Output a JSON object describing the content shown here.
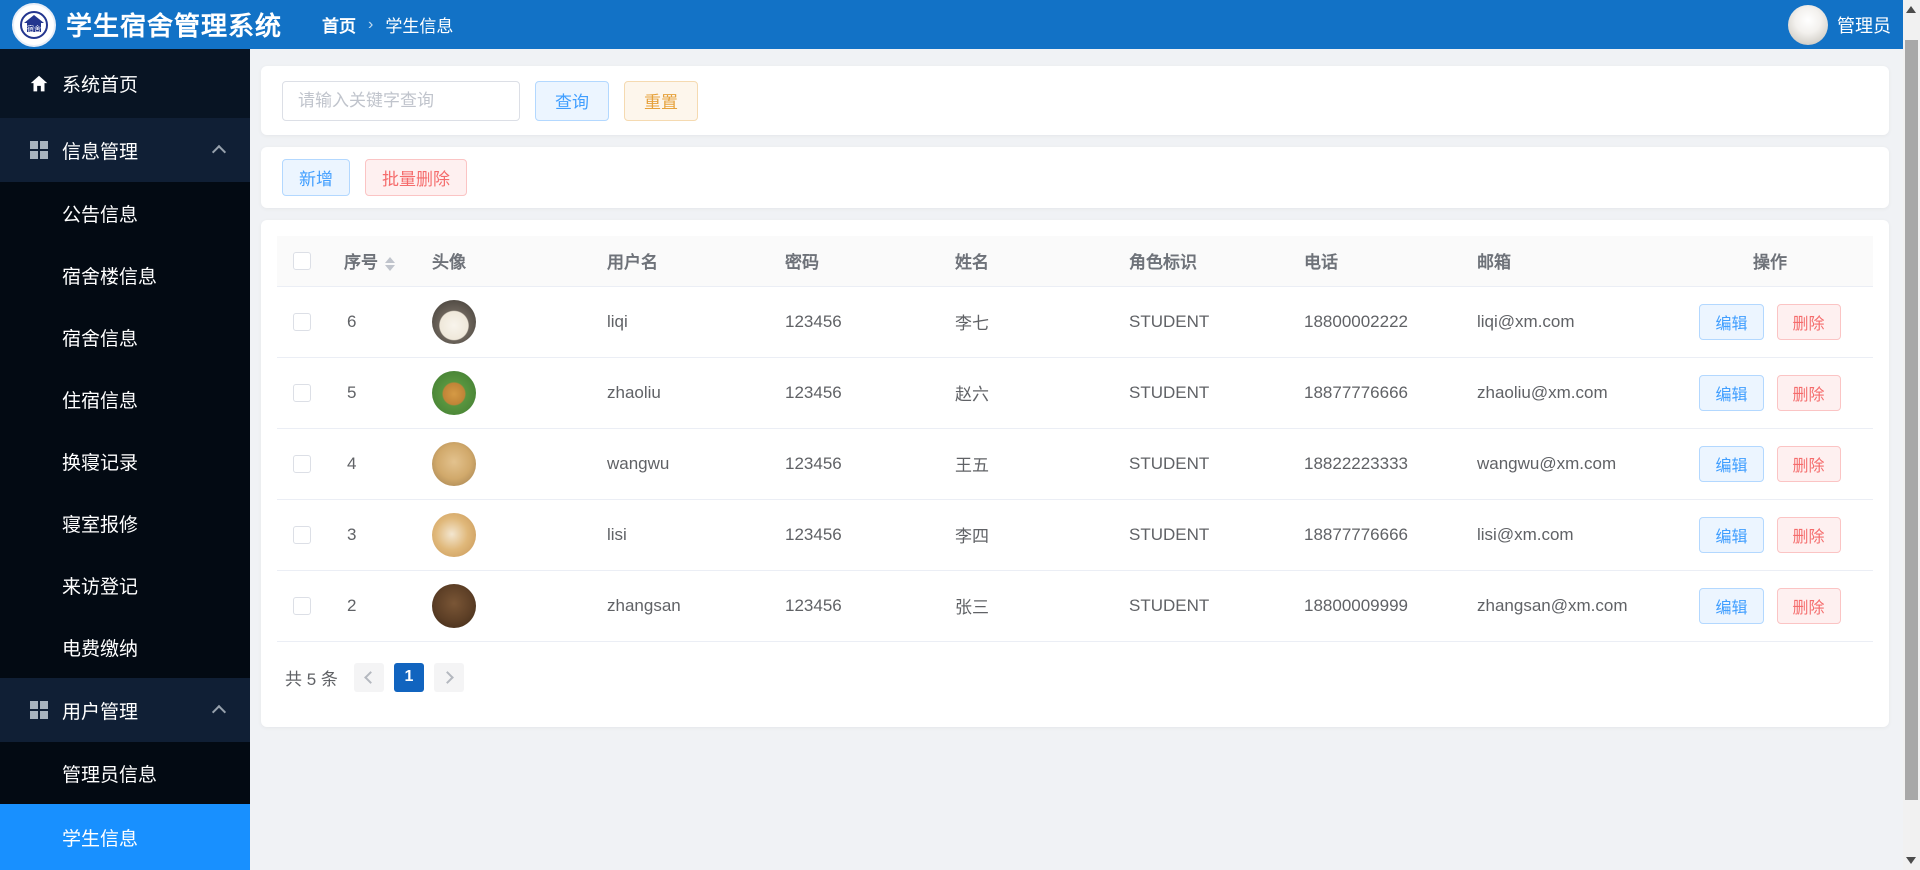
{
  "header": {
    "title": "学生宿舍管理系统",
    "breadcrumb": {
      "home": "首页",
      "separator": "›",
      "current": "学生信息"
    },
    "admin_label": "管理员"
  },
  "sidebar": {
    "items": [
      {
        "label": "系统首页",
        "type": "item"
      },
      {
        "label": "信息管理",
        "type": "group"
      },
      {
        "label": "公告信息",
        "type": "sub"
      },
      {
        "label": "宿舍楼信息",
        "type": "sub"
      },
      {
        "label": "宿舍信息",
        "type": "sub"
      },
      {
        "label": "住宿信息",
        "type": "sub"
      },
      {
        "label": "换寝记录",
        "type": "sub"
      },
      {
        "label": "寝室报修",
        "type": "sub"
      },
      {
        "label": "来访登记",
        "type": "sub"
      },
      {
        "label": "电费缴纳",
        "type": "sub"
      },
      {
        "label": "用户管理",
        "type": "group"
      },
      {
        "label": "管理员信息",
        "type": "sub"
      },
      {
        "label": "学生信息",
        "type": "sub",
        "active": true
      }
    ]
  },
  "search": {
    "placeholder": "请输入关键字查询",
    "query_label": "查询",
    "reset_label": "重置"
  },
  "toolbar": {
    "add_label": "新增",
    "batch_delete_label": "批量删除"
  },
  "table": {
    "columns": {
      "index": "序号",
      "avatar": "头像",
      "username": "用户名",
      "password": "密码",
      "name": "姓名",
      "role": "角色标识",
      "phone": "电话",
      "email": "邮箱",
      "actions": "操作"
    },
    "rows": [
      {
        "no": "6",
        "username": "liqi",
        "password": "123456",
        "name": "李七",
        "role": "STUDENT",
        "phone": "18800002222",
        "email": "liqi@xm.com",
        "avatar": "white-dog-photo"
      },
      {
        "no": "5",
        "username": "zhaoliu",
        "password": "123456",
        "name": "赵六",
        "role": "STUDENT",
        "phone": "18877776666",
        "email": "zhaoliu@xm.com",
        "avatar": "golden-retriever-photo"
      },
      {
        "no": "4",
        "username": "wangwu",
        "password": "123456",
        "name": "王五",
        "role": "STUDENT",
        "phone": "18822223333",
        "email": "wangwu@xm.com",
        "avatar": "labrador-puppy-photo"
      },
      {
        "no": "3",
        "username": "lisi",
        "password": "123456",
        "name": "李四",
        "role": "STUDENT",
        "phone": "18877776666",
        "email": "lisi@xm.com",
        "avatar": "corgi-puppy-photo"
      },
      {
        "no": "2",
        "username": "zhangsan",
        "password": "123456",
        "name": "张三",
        "role": "STUDENT",
        "phone": "18800009999",
        "email": "zhangsan@xm.com",
        "avatar": "brown-puppy-photo"
      }
    ],
    "edit_label": "编辑",
    "delete_label": "删除"
  },
  "pagination": {
    "total_text": "共 5 条",
    "current_page": "1"
  },
  "icons": {
    "logo": "house-badge",
    "sidebar_home": "house",
    "sidebar_group": "grid-2x2",
    "group_state": "chevron-up",
    "sort": "caret-up-down",
    "pager_prev": "chevron-left",
    "pager_next": "chevron-right",
    "scrollbar": "arrow-up-down"
  },
  "colors": {
    "header_blue": "#1272c6",
    "sidebar_active_blue": "#1890ff",
    "primary_blue": "#409eff",
    "danger_red": "#f56c6c",
    "warning_orange": "#e6a23c",
    "pager_active_blue": "#1164bf",
    "content_background": "#f0f2f5"
  }
}
